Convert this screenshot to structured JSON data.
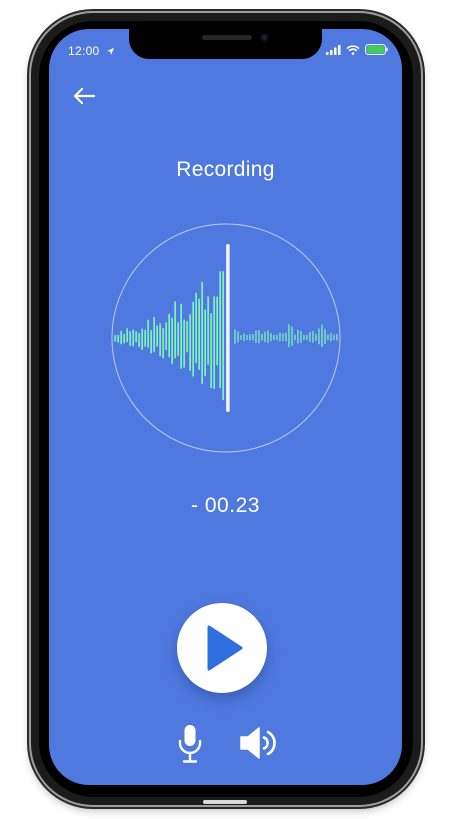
{
  "status_bar": {
    "time": "12:00",
    "icons": [
      "location-arrow-icon",
      "signal-icon",
      "wifi-icon",
      "battery-icon"
    ],
    "battery_color": "#3CD05A"
  },
  "header": {
    "back_icon": "back-arrow-icon",
    "title": "Recording"
  },
  "waveform": {
    "gradient_colors": [
      "#2FE4D6",
      "#6CE0C4",
      "#D9F29A"
    ],
    "playhead_color": "#FFFFFF"
  },
  "playback": {
    "time_remaining": "- 00.23"
  },
  "controls": {
    "play_icon": "play-icon",
    "mic_icon": "microphone-icon",
    "speaker_icon": "speaker-icon"
  },
  "colors": {
    "screen_background": "#5079DF",
    "play_triangle": "#2F6FE0"
  }
}
